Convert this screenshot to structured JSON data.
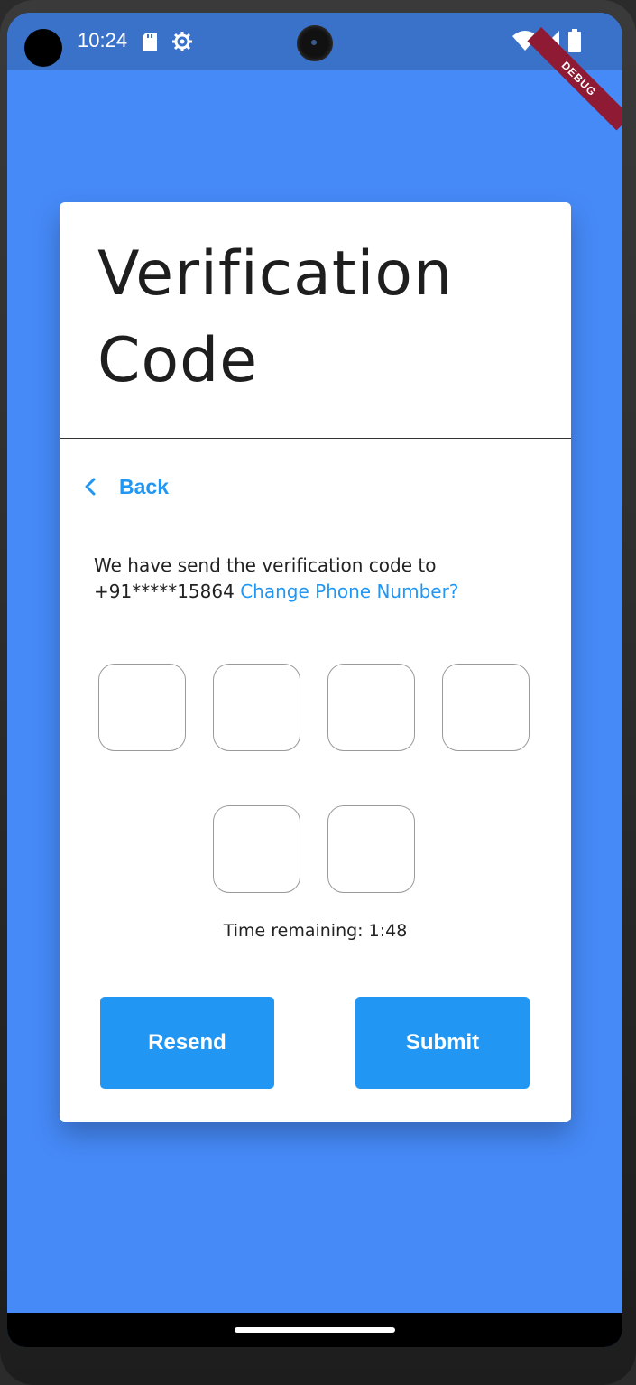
{
  "status_bar": {
    "time": "10:24",
    "icons": [
      "sd-card-icon",
      "gear-icon",
      "wifi-icon",
      "signal-icon",
      "battery-icon"
    ],
    "debug_banner": "DEBUG",
    "background": "#3b72c9"
  },
  "colors": {
    "screen_background": "#468af8",
    "accent": "#2196f3",
    "card": "#ffffff"
  },
  "card": {
    "title_line1": "Verification",
    "title_line2": "Code",
    "back_label": "Back",
    "message_text": "We have send the verification code to +91*****15864",
    "change_link": "Change Phone Number?",
    "otp_values": [
      "",
      "",
      "",
      "",
      "",
      ""
    ],
    "timer_text": "Time remaining: 1:48",
    "resend_label": "Resend",
    "submit_label": "Submit"
  }
}
